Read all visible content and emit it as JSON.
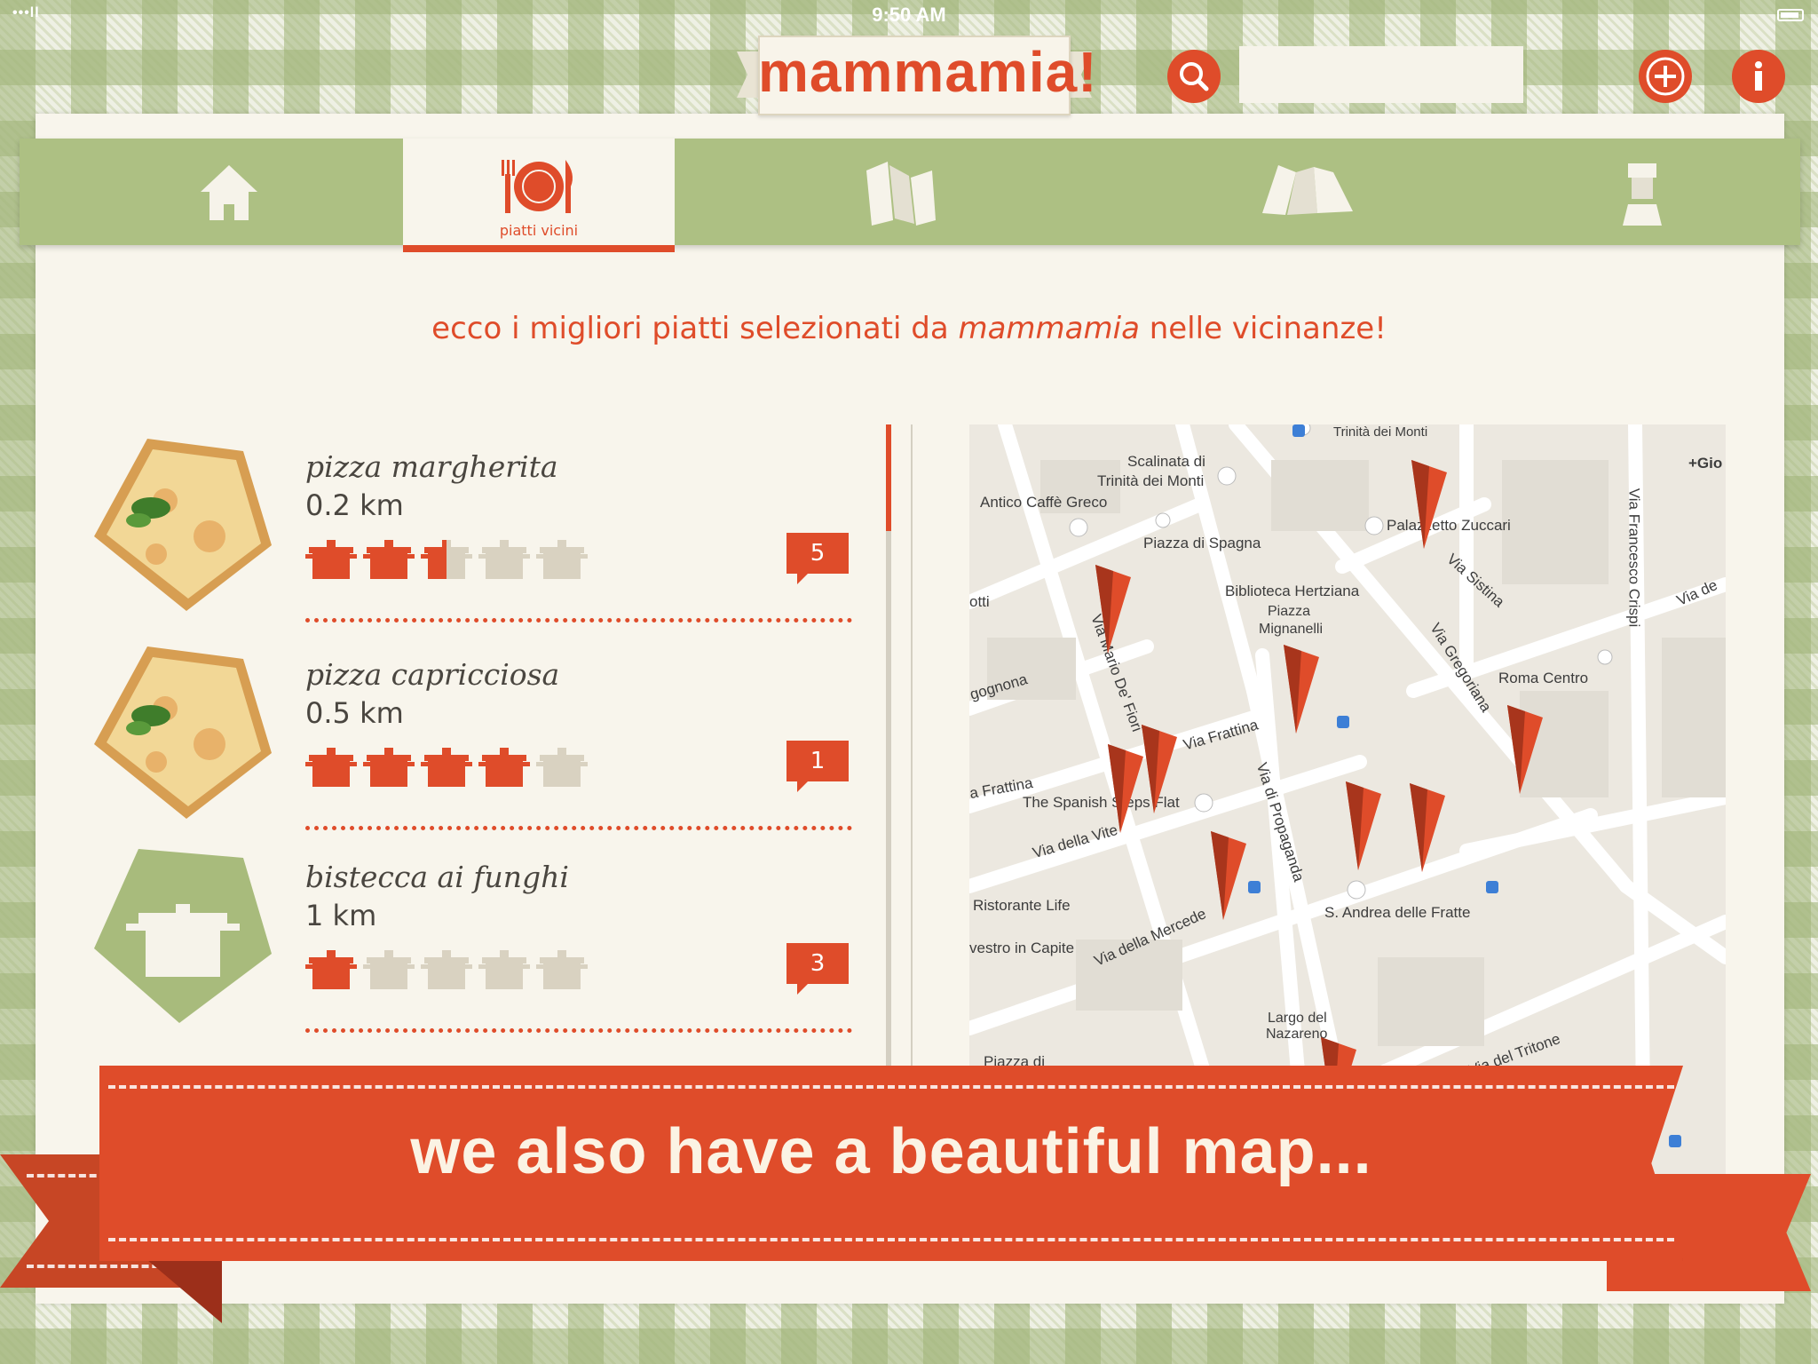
{
  "status_bar": {
    "carrier": "•••ll",
    "time": "9:50 AM"
  },
  "app": {
    "logo": "mammamia!"
  },
  "search": {
    "placeholder": ""
  },
  "nav": {
    "tabs": [
      {
        "id": "home",
        "icon": "home-icon",
        "label": ""
      },
      {
        "id": "nearby-dishes",
        "icon": "plate-cutlery-icon",
        "label": "piatti vicini",
        "active": true
      },
      {
        "id": "map",
        "icon": "folded-map-icon",
        "label": ""
      },
      {
        "id": "maps",
        "icon": "city-map-icon",
        "label": ""
      },
      {
        "id": "profile",
        "icon": "chef-icon",
        "label": ""
      }
    ]
  },
  "headline": {
    "pre": "ecco i migliori piatti selezionati da ",
    "brand": "mammamia",
    "post": " nelle vicinanze!"
  },
  "dishes": [
    {
      "name": "pizza margherita",
      "distance": "0.2 km",
      "rating": 2.5,
      "reviews": "5",
      "image": "pizza-photo"
    },
    {
      "name": "pizza capricciosa",
      "distance": "0.5 km",
      "rating": 4,
      "reviews": "1",
      "image": "pizza-photo"
    },
    {
      "name": "bistecca ai funghi",
      "distance": "1 km",
      "rating": 1,
      "reviews": "3",
      "image": "pot-placeholder-icon"
    }
  ],
  "map": {
    "labels": [
      "Trinità dei Monti",
      "Scalinata di",
      "Trinità dei Monti",
      "Antico Caffè Greco",
      "Piazza di Spagna",
      "Palazzetto Zuccari",
      "Biblioteca Hertziana",
      "Piazza",
      "Mignanelli",
      "Via Sistina",
      "Via Gregoriana",
      "Roma Centro",
      "Via Francesco Crispi",
      "Via Mario De' Fiori",
      "Via Frattina",
      "Via di Propaganda",
      "The Spanish Steps Flat",
      "Via della Vite",
      "Ristorante Life",
      "Via della Mercede",
      "S. Andrea delle Fratte",
      "Largo del",
      "Nazareno",
      "Via del Tritone",
      "+Gio",
      "Via de",
      "otti",
      "gognona",
      "a Frattina",
      "vestro in Capite",
      "Piazza di"
    ]
  },
  "banner": {
    "text": "we also have a beautiful map..."
  },
  "colors": {
    "accent": "#df4c2a",
    "nav_green": "#adc083",
    "panel": "#f8f5ec"
  }
}
